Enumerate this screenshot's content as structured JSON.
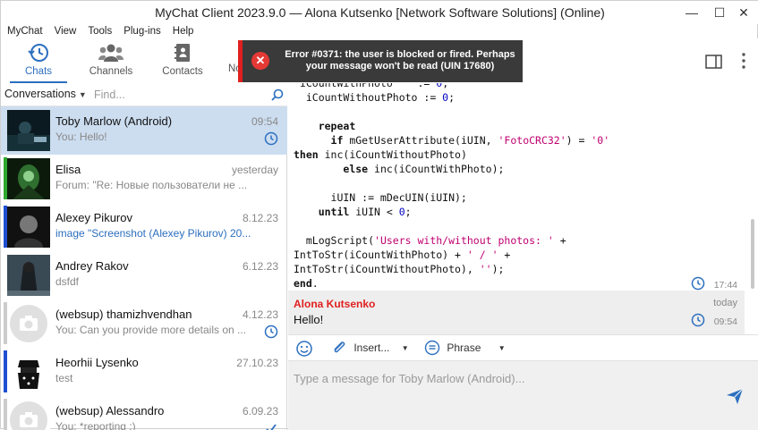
{
  "window": {
    "title": "MyChat Client 2023.9.0 — Alona Kutsenko [Network Software Solutions] (Online)",
    "minimize": "—",
    "maximize": "☐",
    "close": "✕"
  },
  "menu": [
    "MyChat",
    "View",
    "Tools",
    "Plug-ins",
    "Help"
  ],
  "toolbar": {
    "chats": "Chats",
    "channels": "Channels",
    "contacts": "Contacts",
    "notes": "No"
  },
  "error": {
    "icon": "✕",
    "text": "Error #0371: the user is blocked or fired. Perhaps your message won't be read (UIN 17680)"
  },
  "sidebar": {
    "selector": "Conversations",
    "find_placeholder": "Find...",
    "conversations": [
      {
        "name": "Toby Marlow (Android)",
        "preview": "You: Hello!",
        "date": "09:54",
        "status": "clock-icon",
        "selected": true,
        "bar_color": "",
        "preview_blue": false
      },
      {
        "name": "Elisa",
        "preview": "Forum: \"Re: Новые пользователи не ...",
        "date": "yesterday",
        "status": "",
        "selected": false,
        "bar_color": "#2ea82e",
        "preview_blue": false
      },
      {
        "name": "Alexey Pikurov",
        "preview": "image \"Screenshot (Alexey Pikurov) 20...",
        "date": "8.12.23",
        "status": "",
        "selected": false,
        "bar_color": "#1f4fd1",
        "preview_blue": true
      },
      {
        "name": "Andrey Rakov",
        "preview": "dsfdf",
        "date": "6.12.23",
        "status": "",
        "selected": false,
        "bar_color": "",
        "preview_blue": false
      },
      {
        "name": "(websup) thamizhvendhan",
        "preview": "You: Can you provide more details on ...",
        "date": "4.12.23",
        "status": "clock-icon",
        "selected": false,
        "bar_color": "#cccccc",
        "preview_blue": false
      },
      {
        "name": "Heorhii Lysenko",
        "preview": "test",
        "date": "27.10.23",
        "status": "",
        "selected": false,
        "bar_color": "#1f4fd1",
        "preview_blue": false
      },
      {
        "name": "(websup) Alessandro",
        "preview": "You: *reporting :)",
        "date": "6.09.23",
        "status": "check-icon",
        "selected": false,
        "bar_color": "#cccccc",
        "preview_blue": false
      }
    ]
  },
  "chat": {
    "code_time": "17:44",
    "message": {
      "sender": "Alona Kutsenko",
      "text": "Hello!",
      "day": "today",
      "time": "09:54"
    }
  },
  "compose": {
    "insert_label": "Insert...",
    "phrase_label": "Phrase",
    "placeholder": "Type a message for Toby Marlow (Android)..."
  }
}
